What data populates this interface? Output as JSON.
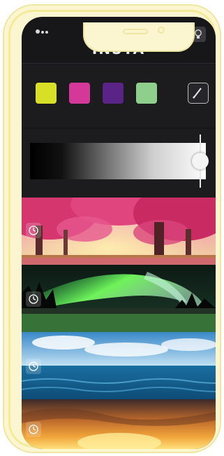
{
  "app": {
    "title": "INSTA"
  },
  "swatches": [
    {
      "name": "yellow",
      "color": "#d8df27"
    },
    {
      "name": "pink",
      "color": "#d4399a"
    },
    {
      "name": "purple",
      "color": "#5a2386"
    },
    {
      "name": "green",
      "color": "#8ecf8e"
    }
  ],
  "pen": {
    "icon": "pen-icon"
  },
  "brightness": {
    "level": 0.97
  },
  "scenes": [
    {
      "name": "cherry-blossom-forest",
      "icon": "clock-icon"
    },
    {
      "name": "northern-lights",
      "icon": "clock-icon"
    },
    {
      "name": "ocean-horizon",
      "icon": "clock-icon"
    },
    {
      "name": "sunset-sky",
      "icon": "clock-icon"
    }
  ],
  "colors": {
    "frame": "#fbf6cf",
    "screen": "#17171a"
  }
}
